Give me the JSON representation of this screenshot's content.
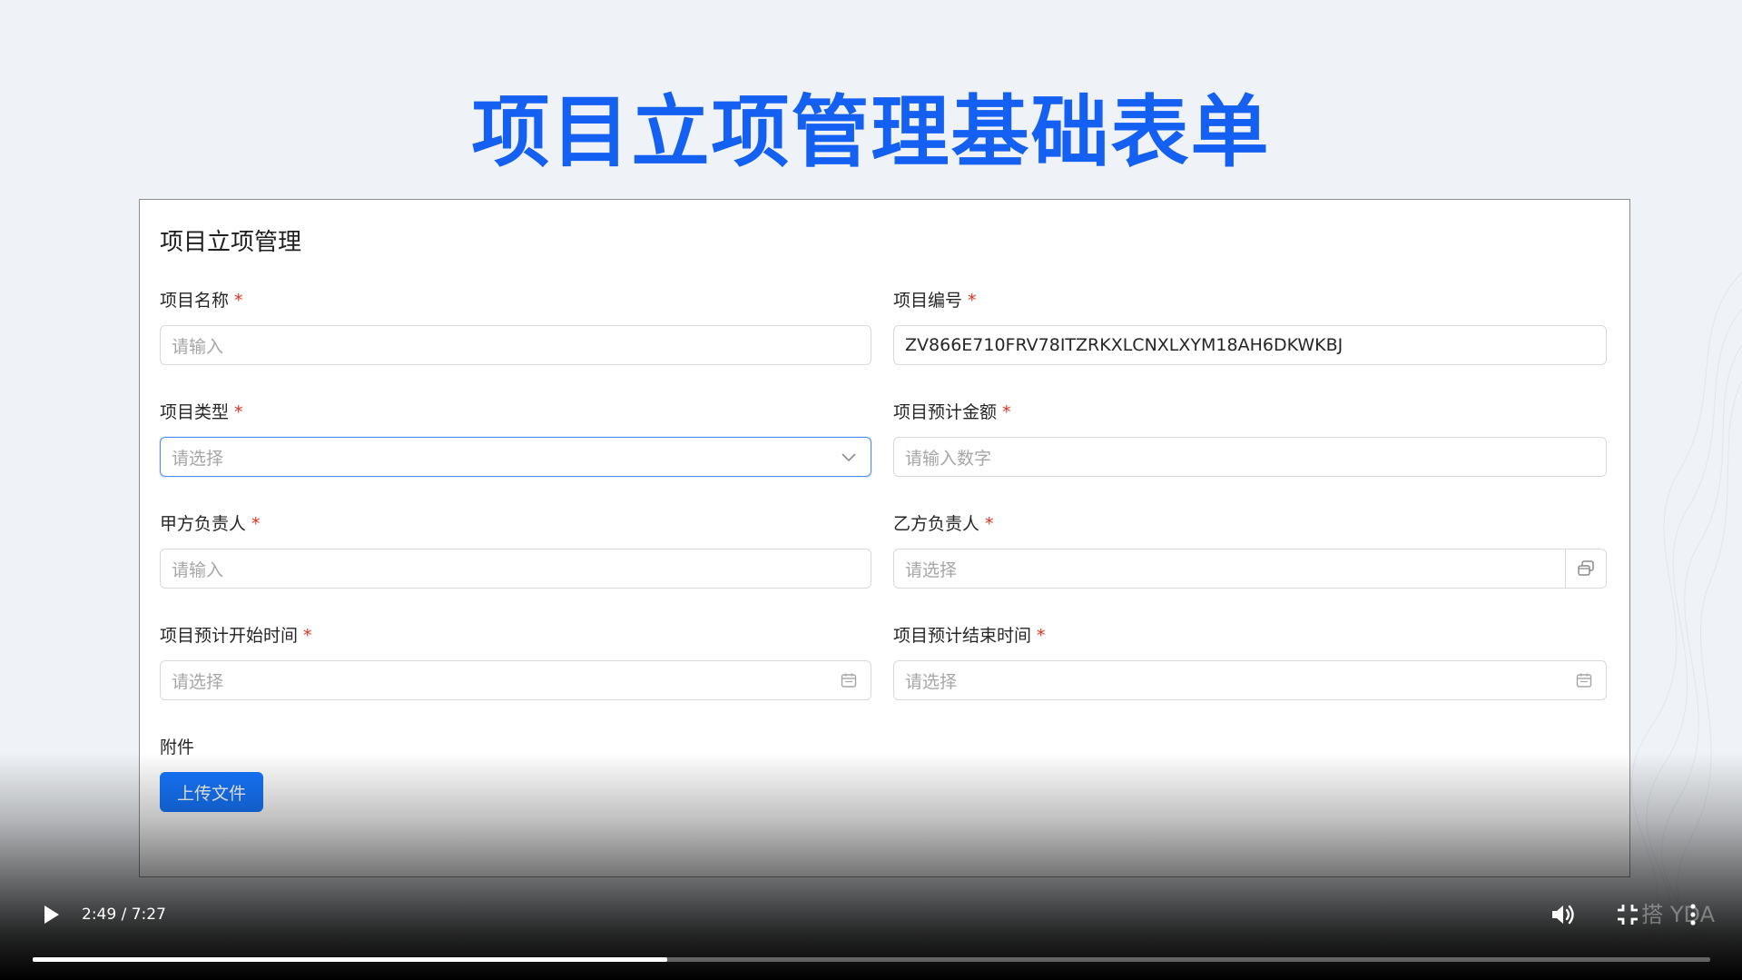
{
  "slide": {
    "title": "项目立项管理基础表单"
  },
  "form": {
    "heading": "项目立项管理",
    "required_mark": "*",
    "fields": {
      "project_name": {
        "label": "项目名称",
        "placeholder": "请输入"
      },
      "project_code": {
        "label": "项目编号",
        "value": "ZV866E710FRV78ITZRKXLCNXLXYM18AH6DKWKBJ"
      },
      "project_type": {
        "label": "项目类型",
        "placeholder": "请选择"
      },
      "estimated_amount": {
        "label": "项目预计金额",
        "placeholder": "请输入数字"
      },
      "party_a_lead": {
        "label": "甲方负责人",
        "placeholder": "请输入"
      },
      "party_b_lead": {
        "label": "乙方负责人",
        "placeholder": "请选择"
      },
      "start_time": {
        "label": "项目预计开始时间",
        "placeholder": "请选择"
      },
      "end_time": {
        "label": "项目预计结束时间",
        "placeholder": "请选择"
      },
      "attachment": {
        "label": "附件",
        "button_label": "上传文件"
      }
    }
  },
  "player": {
    "time": "2:49 / 7:27",
    "progress": 0.378,
    "watermark": "搭 YDA",
    "icons": [
      "play-icon",
      "volume-icon",
      "exit-fullscreen-icon",
      "more-options-icon"
    ]
  },
  "colors": {
    "title_blue": "#1460f2",
    "primary_button": "#1677ff",
    "required_red": "#e0301e",
    "focus_border": "#4a8ff0"
  }
}
